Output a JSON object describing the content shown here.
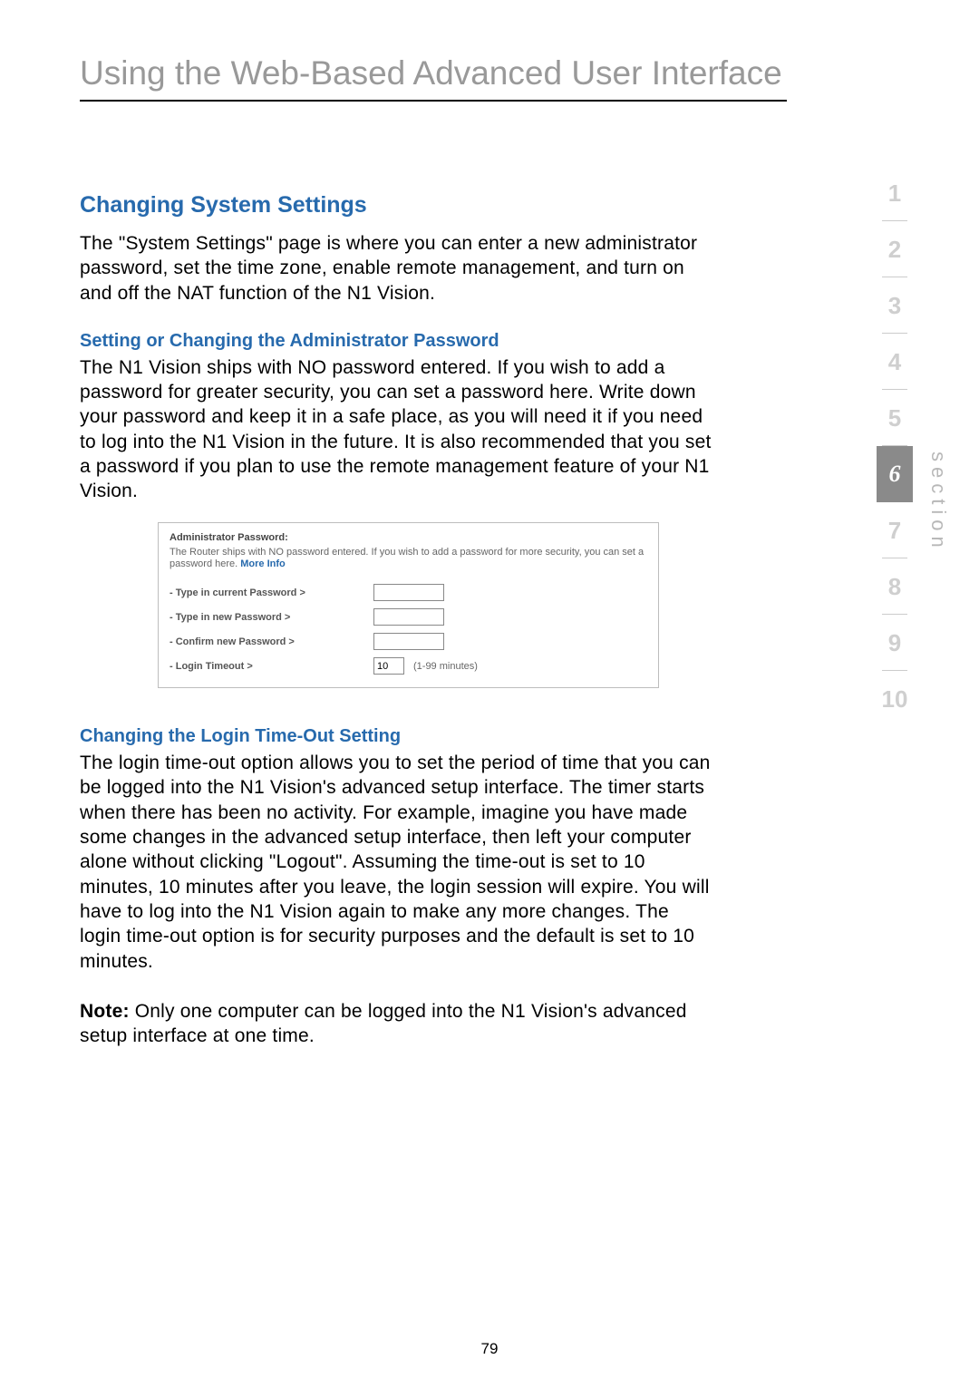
{
  "chapter_title": "Using the Web-Based Advanced User Interface",
  "section_heading": "Changing System Settings",
  "intro_para": "The \"System Settings\" page is where you can enter a new administrator password, set the time zone, enable remote management, and turn on and off the NAT function of the N1 Vision.",
  "sub1_heading": "Setting or Changing the Administrator Password",
  "sub1_para": "The N1 Vision ships with NO password entered. If you wish to add a password for greater security, you can set a password here. Write down your password and keep it in a safe place, as you will need it if you need to log into the N1 Vision in the future. It is also recommended that you set a password if you plan to use the remote management feature of your N1 Vision.",
  "screenshot": {
    "title": "Administrator Password:",
    "desc_pre": "The Router ships with NO password entered. If you wish to add a password for more security, you can set a password here. ",
    "more_info": "More Info",
    "rows": {
      "r1": "- Type in current Password >",
      "r2": "- Type in new Password >",
      "r3": "- Confirm new Password >",
      "r4": "- Login Timeout >"
    },
    "timeout_value": "10",
    "timeout_suffix": "(1-99 minutes)"
  },
  "sub2_heading": "Changing the Login Time-Out Setting",
  "sub2_para": "The login time-out option allows you to set the period of time that you can be logged into the N1 Vision's advanced setup interface. The timer starts when there has been no activity. For example, imagine you have made some changes in the advanced setup interface, then left your computer alone without clicking \"Logout\". Assuming the time-out is set to 10 minutes, 10 minutes after you leave, the login session will expire. You will have to log into the N1 Vision again to make any more changes. The login time-out option is for security purposes and the default is set to 10 minutes.",
  "note_bold": "Note:",
  "note_text": " Only one computer can be logged into the N1 Vision's advanced setup interface at one time.",
  "nav": {
    "items": [
      "1",
      "2",
      "3",
      "4",
      "5",
      "6",
      "7",
      "8",
      "9",
      "10"
    ],
    "current_index": 5,
    "section_label": "section"
  },
  "page_number": "79"
}
